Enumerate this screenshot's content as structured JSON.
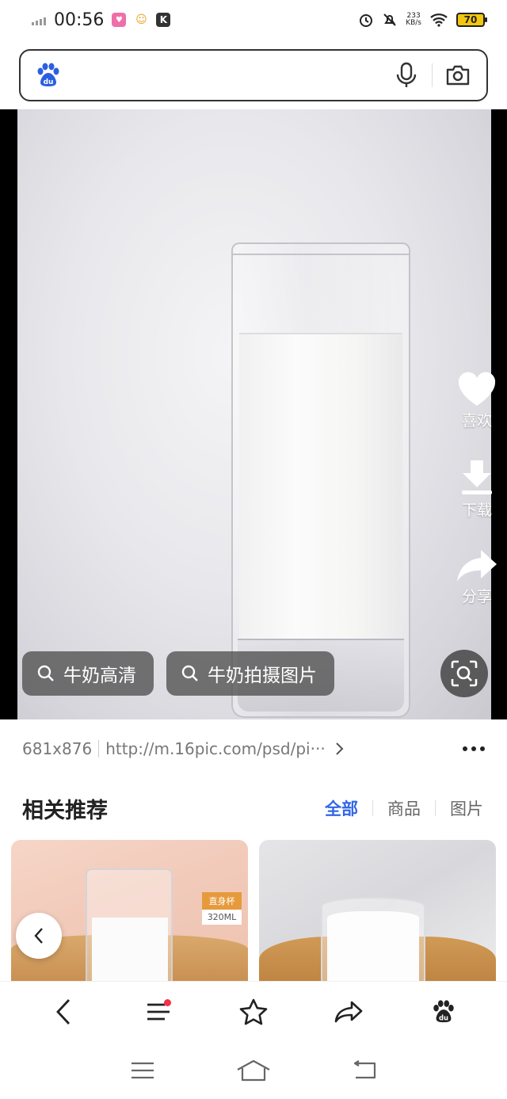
{
  "status_bar": {
    "time": "00:56",
    "net_speed_value": "233",
    "net_speed_unit": "KB/s",
    "battery": "70",
    "icons": [
      "signal-icon",
      "app-icon-1",
      "app-icon-2",
      "app-icon-k",
      "alarm-icon",
      "mute-icon",
      "wifi-icon",
      "battery-icon"
    ]
  },
  "search": {
    "placeholder": "",
    "logo": "baidu-paw-logo",
    "icons": [
      "microphone-icon",
      "camera-icon"
    ]
  },
  "viewer": {
    "actions": [
      {
        "icon": "heart-icon",
        "label": "喜欢"
      },
      {
        "icon": "download-icon",
        "label": "下载"
      },
      {
        "icon": "share-icon",
        "label": "分享"
      }
    ],
    "chips": [
      "牛奶高清",
      "牛奶拍摄图片"
    ]
  },
  "info": {
    "dimensions": "681x876",
    "url": "http://m.16pic.com/psd/pi···"
  },
  "recommend": {
    "title": "相关推荐",
    "tabs": [
      "全部",
      "商品",
      "图片"
    ],
    "active_tab": "全部",
    "card1_tag_top": "直身杯",
    "card1_tag_bottom": "320ML"
  },
  "colors": {
    "accent": "#3366e6",
    "notification_dot": "#f0334a",
    "battery": "#f3c60f"
  }
}
